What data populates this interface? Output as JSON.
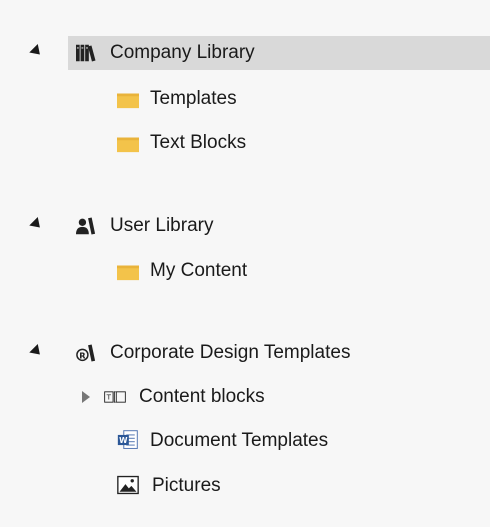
{
  "tree": {
    "company_library": {
      "label": "Company Library",
      "children": [
        "Templates",
        "Text Blocks"
      ]
    },
    "user_library": {
      "label": "User Library",
      "children": [
        "My Content"
      ]
    },
    "corporate_design": {
      "label": "Corporate Design Templates",
      "children": [
        "Content blocks",
        "Document Templates",
        "Pictures"
      ]
    }
  },
  "colors": {
    "selected_bg": "#d9d9d9",
    "folder": "#f3c34a",
    "word_blue": "#2b5797"
  }
}
